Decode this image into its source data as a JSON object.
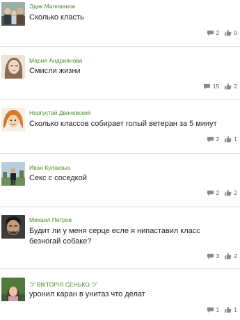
{
  "posts": [
    {
      "author": "Эдик Милованов",
      "text": "Сколько класть",
      "comments": "2",
      "likes": "0"
    },
    {
      "author": "Мария Андриянова",
      "text": "Смисли жизни",
      "comments": "15",
      "likes": "2"
    },
    {
      "author": "Норгустай Двачевский",
      "text": "Сколько классов собирает голый ветеран за 5 минут",
      "comments": "2",
      "likes": "1"
    },
    {
      "author": "Иван Кулакзыз",
      "text": "Секс с соседкой",
      "comments": "2",
      "likes": "2"
    },
    {
      "author": "Михаил Петров",
      "text": "Будит ли у меня серце есле я нипаставил класс безногай собаке?",
      "comments": "3",
      "likes": "2"
    },
    {
      "author": "ツ ВІКТОРІЯ СЕНЬКО ツ",
      "text": "уронил каран в унитаз что делат",
      "comments": "1",
      "likes": "1"
    }
  ],
  "icons": {
    "comment": "comment-icon",
    "like": "thumbs-up-icon"
  },
  "colors": {
    "author": "#4f8a2d",
    "text": "#222222",
    "divider": "#d9d9d9",
    "icon": "#8a8a8a"
  }
}
